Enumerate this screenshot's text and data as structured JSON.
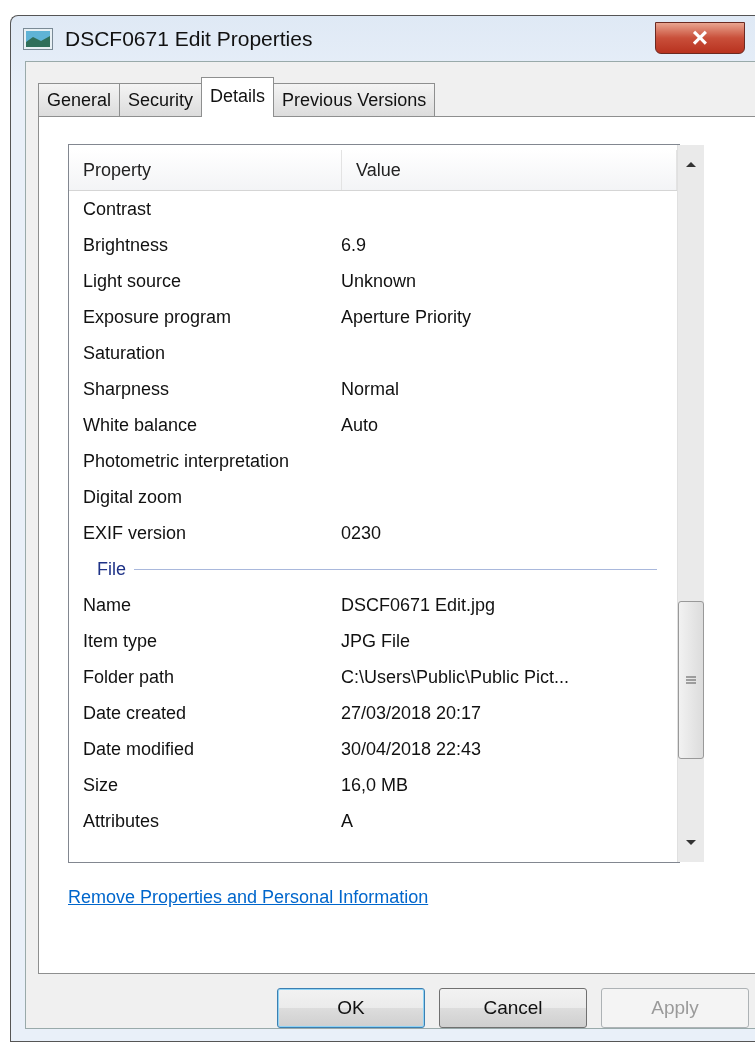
{
  "window": {
    "title": "DSCF0671 Edit Properties",
    "close": "×"
  },
  "tabs": [
    {
      "label": "General",
      "selected": false
    },
    {
      "label": "Security",
      "selected": false
    },
    {
      "label": "Details",
      "selected": true
    },
    {
      "label": "Previous Versions",
      "selected": false
    }
  ],
  "table": {
    "columns": [
      "Property",
      "Value"
    ],
    "rows": [
      {
        "kind": "row",
        "property": "Contrast",
        "value": ""
      },
      {
        "kind": "row",
        "property": "Brightness",
        "value": "6.9"
      },
      {
        "kind": "row",
        "property": "Light source",
        "value": "Unknown"
      },
      {
        "kind": "row",
        "property": "Exposure program",
        "value": "Aperture Priority"
      },
      {
        "kind": "row",
        "property": "Saturation",
        "value": ""
      },
      {
        "kind": "row",
        "property": "Sharpness",
        "value": "Normal"
      },
      {
        "kind": "row",
        "property": "White balance",
        "value": "Auto"
      },
      {
        "kind": "row",
        "property": "Photometric interpretation",
        "value": ""
      },
      {
        "kind": "row",
        "property": "Digital zoom",
        "value": ""
      },
      {
        "kind": "row",
        "property": "EXIF version",
        "value": "0230"
      },
      {
        "kind": "group",
        "property": "File"
      },
      {
        "kind": "row",
        "property": "Name",
        "value": "DSCF0671 Edit.jpg"
      },
      {
        "kind": "row",
        "property": "Item type",
        "value": "JPG File"
      },
      {
        "kind": "row",
        "property": "Folder path",
        "value": "C:\\Users\\Public\\Public Pict..."
      },
      {
        "kind": "row",
        "property": "Date created",
        "value": "27/03/2018 20:17"
      },
      {
        "kind": "row",
        "property": "Date modified",
        "value": "30/04/2018 22:43"
      },
      {
        "kind": "row",
        "property": "Size",
        "value": "16,0 MB"
      },
      {
        "kind": "row",
        "property": "Attributes",
        "value": "A"
      }
    ]
  },
  "link": "Remove Properties and Personal Information",
  "buttons": [
    {
      "label": "OK",
      "disabled": false,
      "default": true
    },
    {
      "label": "Cancel",
      "disabled": false,
      "default": false
    },
    {
      "label": "Apply",
      "disabled": true,
      "default": false
    }
  ]
}
